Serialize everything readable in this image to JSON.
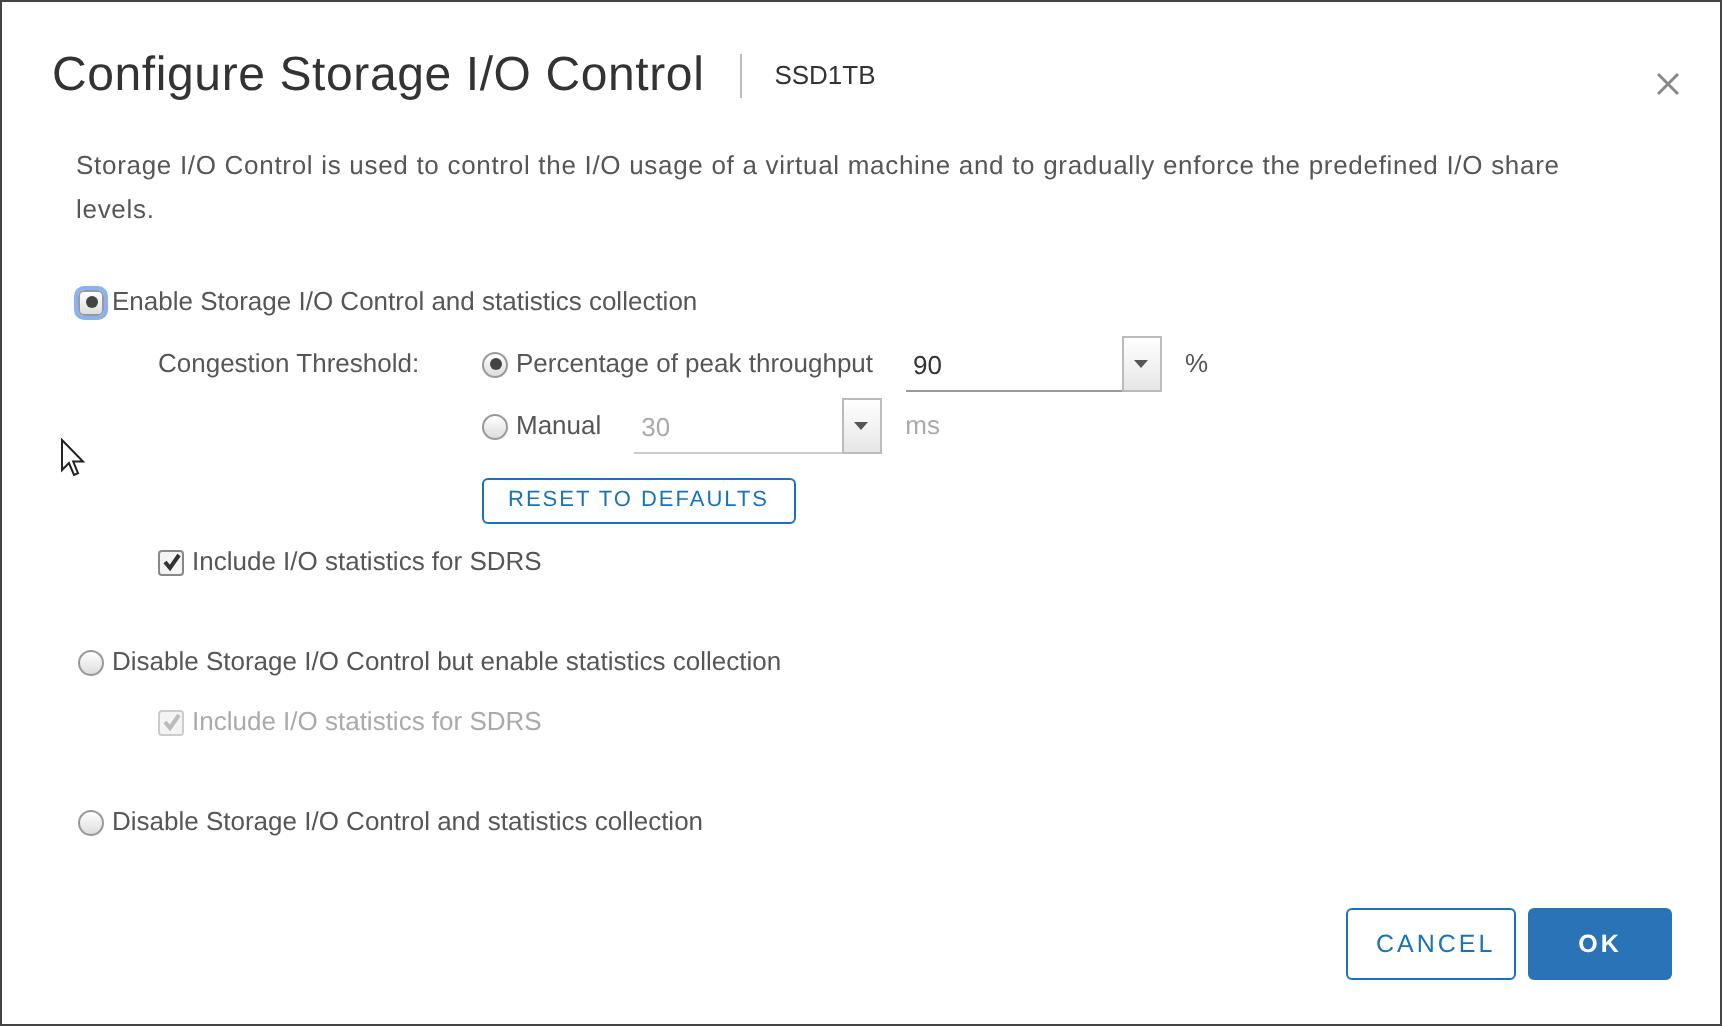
{
  "dialog": {
    "title": "Configure Storage I/O Control",
    "subtitle": "SSD1TB",
    "description": "Storage I/O Control is used to control the I/O usage of a virtual machine and to gradually enforce the predefined I/O share levels."
  },
  "options": [
    {
      "label": "Enable Storage I/O Control and statistics collection",
      "selected": true,
      "focused": true,
      "congestion": {
        "label": "Congestion Threshold:",
        "modes": [
          {
            "label": "Percentage of peak throughput",
            "selected": true,
            "value": "90",
            "unit": "%",
            "disabled": false
          },
          {
            "label": "Manual",
            "selected": false,
            "value": "30",
            "unit": "ms",
            "disabled": true
          }
        ],
        "reset_button": "RESET TO DEFAULTS"
      },
      "checkbox": {
        "label": "Include I/O statistics for SDRS",
        "checked": true,
        "disabled": false
      }
    },
    {
      "label": "Disable Storage I/O Control but enable statistics collection",
      "selected": false,
      "focused": false,
      "checkbox": {
        "label": "Include I/O statistics for SDRS",
        "checked": true,
        "disabled": true
      }
    },
    {
      "label": "Disable Storage I/O Control and statistics collection",
      "selected": false,
      "focused": false
    }
  ],
  "buttons": [
    {
      "label": "CANCEL",
      "kind": "secondary"
    },
    {
      "label": "OK",
      "kind": "primary"
    }
  ]
}
